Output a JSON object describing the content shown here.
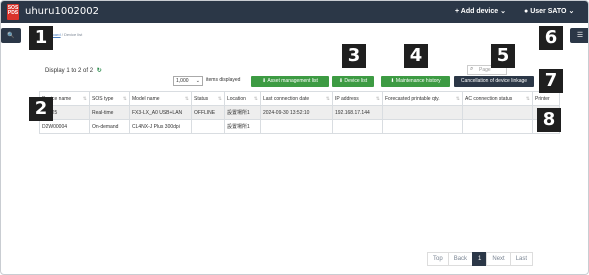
{
  "header": {
    "logo_line1": "SOS",
    "logo_line2": "PDS",
    "title": "uhuru1002002",
    "add_device": "Add device",
    "user": "User SATO",
    "caret": "⌄"
  },
  "icons": {
    "add": "+",
    "user": "●",
    "search": "🔍",
    "menu": "☰",
    "refresh": "↻"
  },
  "breadcrumb": {
    "home": "Dashboard",
    "separator": "/",
    "current": "Device list"
  },
  "count": "Display 1 to 2 of 2",
  "search": {
    "placeholder": "Page"
  },
  "perpage": {
    "value": "1,000",
    "label": "items displayed"
  },
  "buttons": {
    "asset": "⬇ Asset management list",
    "device": "⬇ Device list",
    "maintenance": "⬇ Maintenance history",
    "cancel": "Cancellation of device linkage"
  },
  "table": {
    "columns": [
      "Device name",
      "SOS type",
      "Model name",
      "Status",
      "Location",
      "Last connection date",
      "IP address",
      "Forecasted printable qty.",
      "AC connection status",
      "Printer"
    ],
    "rows": [
      [
        "...0825",
        "Real-time",
        "FX3-LX_A0 USB+LAN",
        "OFFLINE",
        "設置場所1",
        "2024-09-30 13:52:10",
        "192.168.17.144",
        "",
        "",
        ""
      ],
      [
        "D2W00004",
        "On-demand",
        "CL4NX-J Plus 300dpi",
        "",
        "設置場所1",
        "",
        "",
        "",
        "",
        ""
      ]
    ]
  },
  "pagination": {
    "top": "Top",
    "back": "Back",
    "current": "1",
    "next": "Next",
    "last": "Last"
  },
  "badges": [
    "1",
    "2",
    "3",
    "4",
    "5",
    "6",
    "7",
    "8"
  ]
}
